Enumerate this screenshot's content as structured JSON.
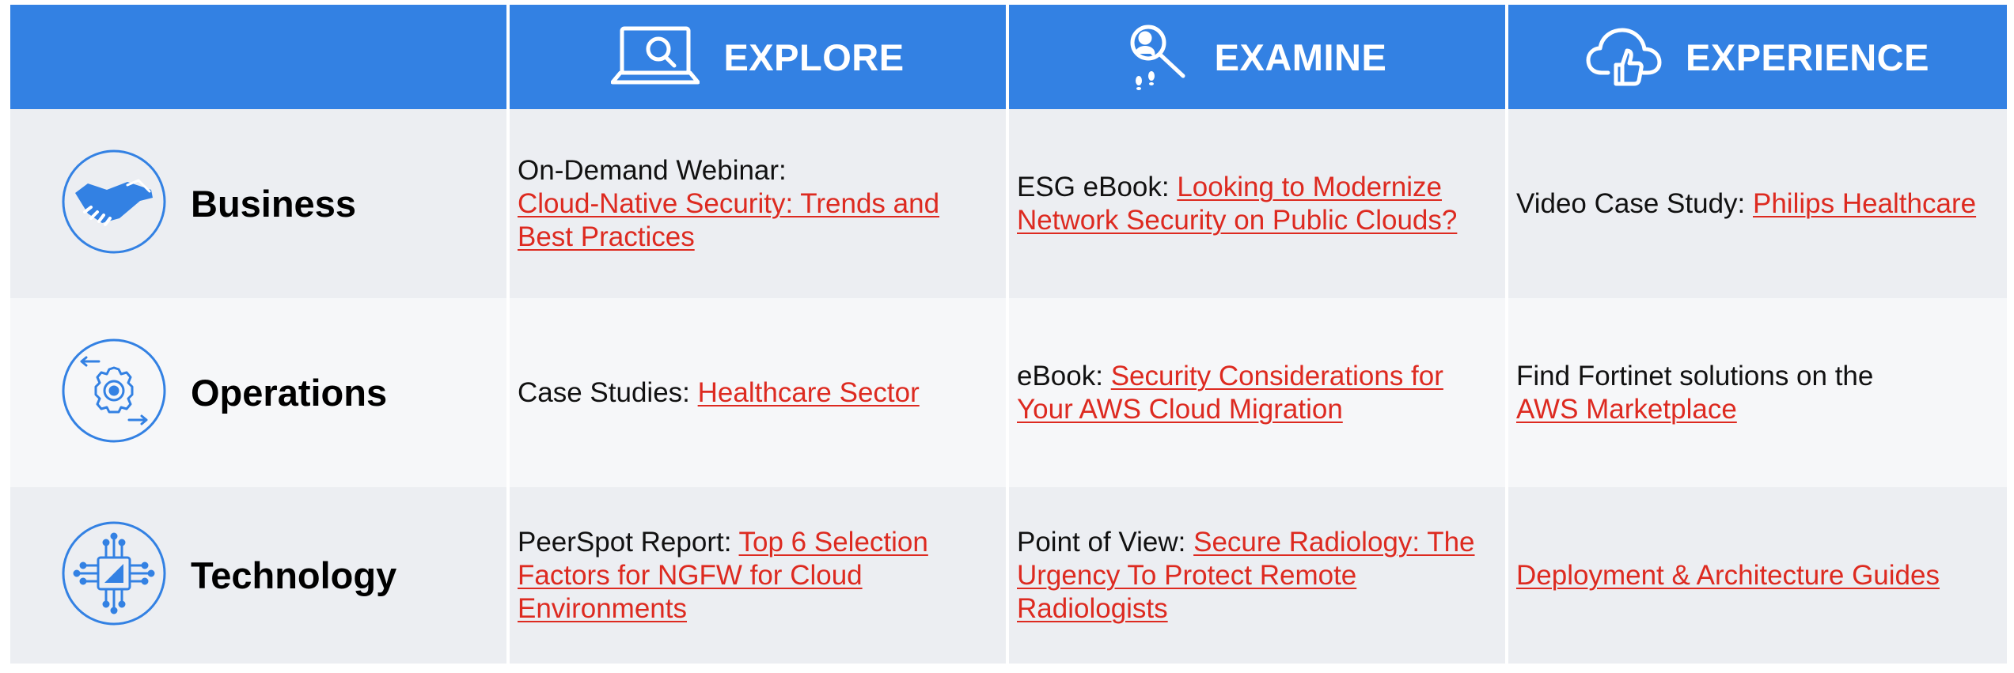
{
  "header": {
    "columns": [
      {
        "label": "EXPLORE",
        "icon": "laptop-search-icon"
      },
      {
        "label": "EXAMINE",
        "icon": "person-magnifier-icon"
      },
      {
        "label": "EXPERIENCE",
        "icon": "cloud-thumbs-up-icon"
      }
    ]
  },
  "rows": [
    {
      "label": "Business",
      "icon": "handshake-icon",
      "explore": {
        "prefix": "On-Demand Webinar:",
        "link": "Cloud-Native Security: Trends and Best Practices"
      },
      "examine": {
        "prefix": "ESG eBook:",
        "link": "Looking to Modernize Network Security on Public Clouds?"
      },
      "experience": {
        "prefix": "Video Case Study:",
        "link": "Philips Healthcare"
      }
    },
    {
      "label": "Operations",
      "icon": "gear-cycle-icon",
      "explore": {
        "prefix": "Case Studies:",
        "link": "Healthcare Sector"
      },
      "examine": {
        "prefix": "eBook:",
        "link": "Security Considerations for Your AWS Cloud Migration"
      },
      "experience": {
        "prefix": "Find Fortinet solutions on the",
        "link": "AWS Marketplace"
      }
    },
    {
      "label": "Technology",
      "icon": "chip-circuit-icon",
      "explore": {
        "prefix": "PeerSpot Report:",
        "link": "Top 6 Selection Factors for NGFW for Cloud Environments"
      },
      "examine": {
        "prefix": "Point of View:",
        "link": "Secure Radiology: The Urgency To Protect Remote Radiologists"
      },
      "experience": {
        "prefix": "",
        "link": "Deployment & Architecture Guides"
      }
    }
  ],
  "colors": {
    "header_bg": "#3381e3",
    "link": "#dd2a20",
    "row_shade_a": "#eceef2",
    "row_shade_b": "#f6f7f9"
  }
}
